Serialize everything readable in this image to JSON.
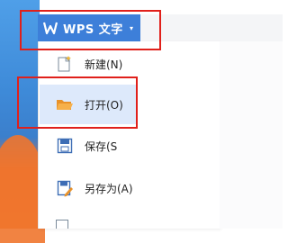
{
  "app_button": {
    "label": "WPS 文字",
    "chevron": "▾",
    "icon": "wps-logo-icon"
  },
  "menu": {
    "items": [
      {
        "label": "新建(N)",
        "icon": "new-document-icon",
        "active": false
      },
      {
        "label": "打开(O)",
        "icon": "open-folder-icon",
        "active": true
      },
      {
        "label": "保存(S",
        "icon": "save-icon",
        "active": false
      },
      {
        "label": "另存为(A)",
        "icon": "save-as-icon",
        "active": false
      }
    ]
  },
  "colors": {
    "accent": "#3d7fd9",
    "highlight": "#e0201b",
    "active_item_bg": "#dde9fb",
    "folder": "#f4a23c"
  }
}
